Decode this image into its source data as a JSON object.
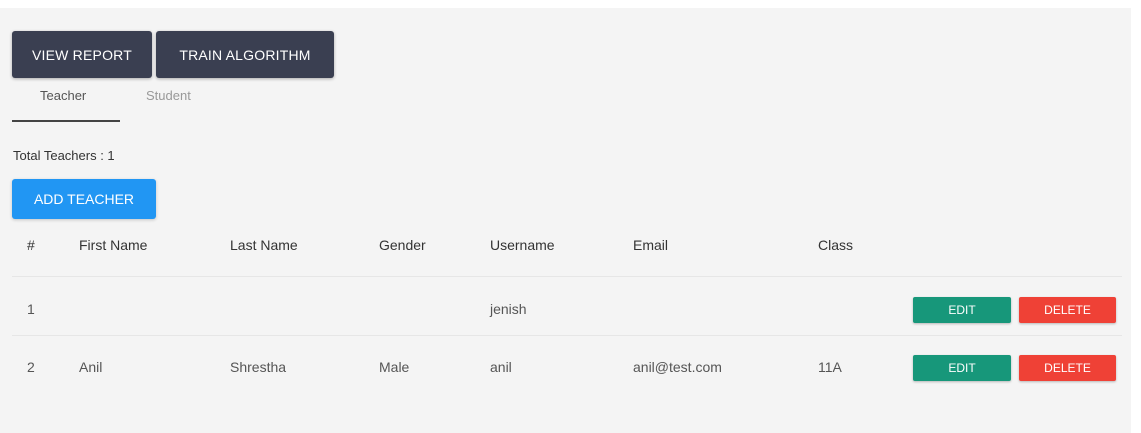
{
  "toolbar": {
    "view_report_label": "VIEW REPORT",
    "train_algorithm_label": "TRAIN ALGORITHM"
  },
  "tabs": [
    {
      "label": "Teacher",
      "active": true
    },
    {
      "label": "Student",
      "active": false
    }
  ],
  "summary": {
    "total_label": "Total Teachers : 1"
  },
  "actions": {
    "add_teacher_label": "ADD TEACHER"
  },
  "table": {
    "columns": [
      "#",
      "First Name",
      "Last Name",
      "Gender",
      "Username",
      "Email",
      "Class"
    ],
    "rows": [
      {
        "index": "1",
        "first_name": "",
        "last_name": "",
        "gender": "",
        "username": "jenish",
        "email": "",
        "class": "",
        "edit_label": "EDIT",
        "delete_label": "DELETE"
      },
      {
        "index": "2",
        "first_name": "Anil",
        "last_name": "Shrestha",
        "gender": "Male",
        "username": "anil",
        "email": "anil@test.com",
        "class": "11A",
        "edit_label": "EDIT",
        "delete_label": "DELETE"
      }
    ]
  },
  "colors": {
    "dark_button": "#3a3f51",
    "primary": "#2196f3",
    "edit": "#17977a",
    "delete": "#ef4136"
  }
}
